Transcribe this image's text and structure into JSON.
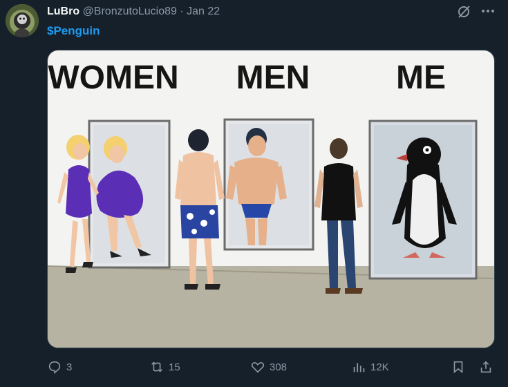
{
  "post": {
    "author_name": "LuBro",
    "author_handle": "@BronzutoLucio89",
    "separator": "·",
    "date": "Jan 22",
    "cashtag": "$Penguin",
    "meme_captions": [
      "WOMEN",
      "MEN",
      "ME"
    ]
  },
  "actions": {
    "replies": "3",
    "reposts": "15",
    "likes": "308",
    "views": "12K"
  },
  "colors": {
    "background": "#15202b",
    "link": "#1d9bf0",
    "muted": "#8b98a5"
  },
  "icons": [
    "avatar",
    "grok-icon",
    "more-icon",
    "reply-icon",
    "repost-icon",
    "like-icon",
    "views-icon",
    "bookmark-icon",
    "share-icon"
  ]
}
